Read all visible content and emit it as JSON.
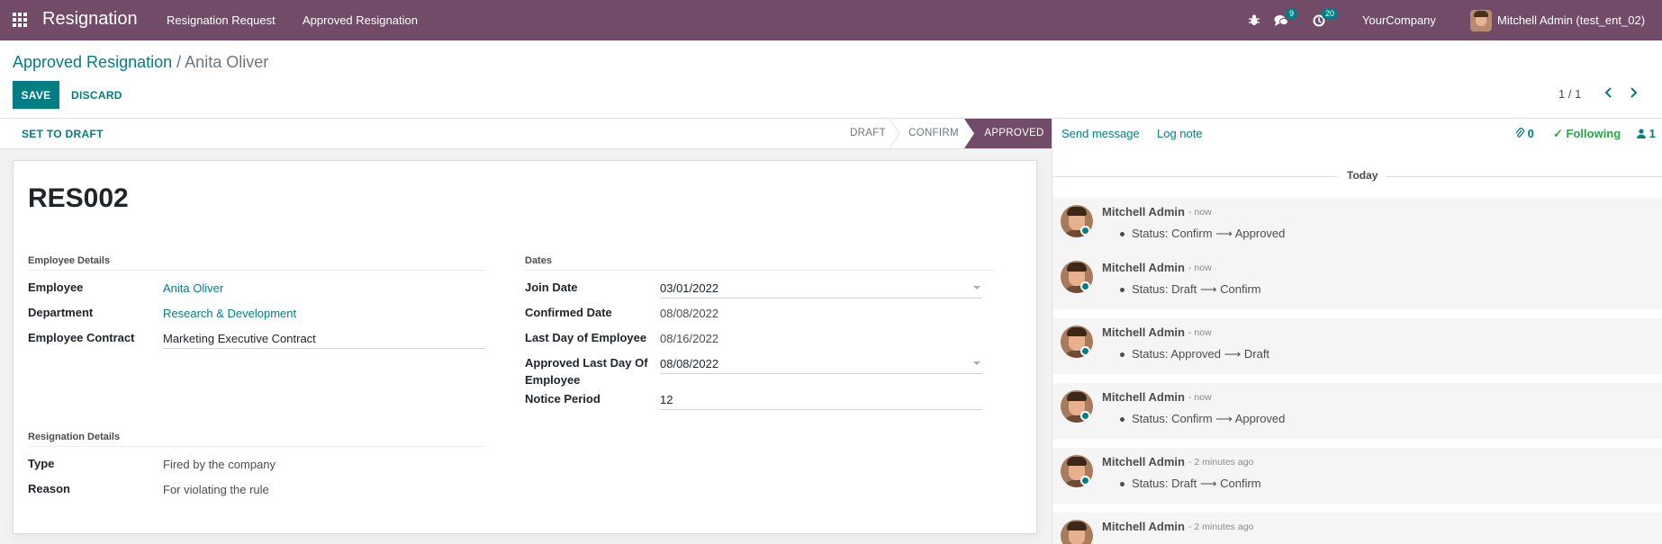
{
  "navbar": {
    "brand": "Resignation",
    "menu": [
      "Resignation Request",
      "Approved Resignation"
    ],
    "messages_count": "9",
    "activities_count": "20",
    "company": "YourCompany",
    "user": "Mitchell Admin (test_ent_02)"
  },
  "control_panel": {
    "breadcrumb_parent": "Approved Resignation",
    "breadcrumb_sep": "/",
    "breadcrumb_current": "Anita Oliver",
    "save_label": "SAVE",
    "discard_label": "DISCARD",
    "pager": "1 / 1"
  },
  "statusbar": {
    "action_label": "SET TO DRAFT",
    "stages": [
      "DRAFT",
      "CONFIRM",
      "APPROVED"
    ],
    "active_stage": "APPROVED"
  },
  "form": {
    "record_name": "RES002",
    "employee_details": {
      "title": "Employee Details",
      "employee_label": "Employee",
      "employee_value": "Anita Oliver",
      "department_label": "Department",
      "department_value": "Research & Development",
      "contract_label": "Employee Contract",
      "contract_value": "Marketing Executive Contract"
    },
    "dates": {
      "title": "Dates",
      "join_label": "Join Date",
      "join_value": "03/01/2022",
      "confirmed_label": "Confirmed Date",
      "confirmed_value": "08/08/2022",
      "last_day_label": "Last Day of Employee",
      "last_day_value": "08/16/2022",
      "approved_last_label_1": "Approved Last Day Of",
      "approved_last_label_2": "Employee",
      "approved_last_value": "08/08/2022",
      "notice_label": "Notice Period",
      "notice_value": "12"
    },
    "resignation_details": {
      "title": "Resignation Details",
      "type_label": "Type",
      "type_value": "Fired by the company",
      "reason_label": "Reason",
      "reason_value": "For violating the rule"
    }
  },
  "chatter": {
    "send_message": "Send message",
    "log_note": "Log note",
    "attachments": "0",
    "following": "Following",
    "followers": "1",
    "today": "Today",
    "messages": [
      {
        "author": "Mitchell Admin",
        "time": "- now",
        "status": "Status: Confirm ⟶ Approved"
      },
      {
        "author": "Mitchell Admin",
        "time": "- now",
        "status": "Status: Draft ⟶ Confirm"
      },
      {
        "author": "Mitchell Admin",
        "time": "- now",
        "status": "Status: Approved ⟶ Draft"
      },
      {
        "author": "Mitchell Admin",
        "time": "- now",
        "status": "Status: Confirm ⟶ Approved"
      },
      {
        "author": "Mitchell Admin",
        "time": "- 2 minutes ago",
        "status": "Status: Draft ⟶ Confirm"
      },
      {
        "author": "Mitchell Admin",
        "time": "- 2 minutes ago",
        "status": ""
      }
    ]
  },
  "colors": {
    "brand": "#714b67",
    "accent": "#017e84",
    "following": "#28a745"
  }
}
